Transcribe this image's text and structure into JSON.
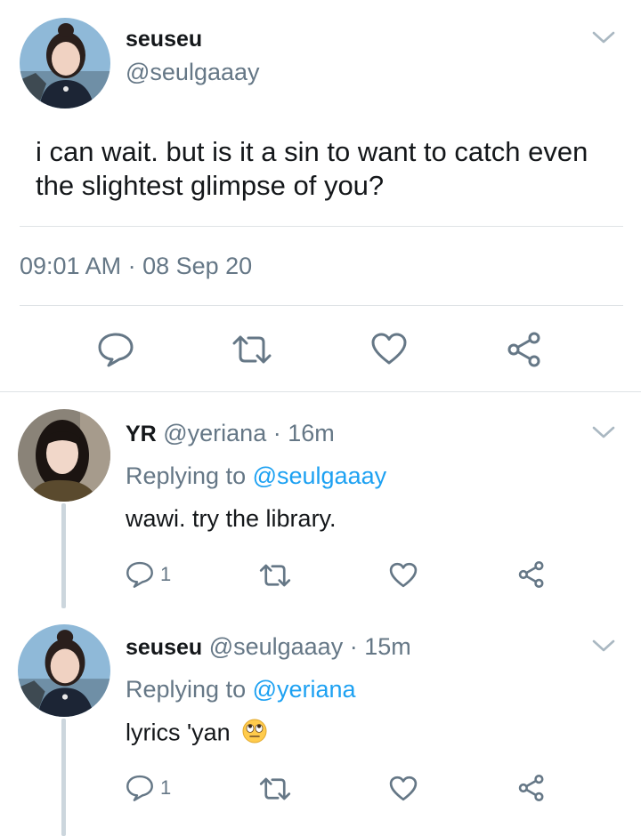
{
  "tweet": {
    "name": "seuseu",
    "handle": "@seulgaaay",
    "text": "i can wait. but is it a sin to want to catch even the slightest glimpse of you?",
    "timestamp": "09:01 AM · 08 Sep 20"
  },
  "replies": [
    {
      "name": "YR",
      "handle": "@yeriana",
      "time": "· 16m",
      "replying_prefix": "Replying to ",
      "replying_to": "@seulgaaay",
      "text": "wawi. try the library.",
      "reply_count": "1"
    },
    {
      "name": "seuseu",
      "handle": "@seulgaaay",
      "time": "· 15m",
      "replying_prefix": "Replying to ",
      "replying_to": "@yeriana",
      "text": "lyrics 'yan",
      "reply_count": "1"
    }
  ],
  "colors": {
    "text": "#14171a",
    "secondary": "#657786",
    "link": "#1da1f2",
    "divider": "#dfe3e6",
    "thread_line": "#ccd6dd"
  },
  "icons": [
    "chevron-down-icon",
    "reply-icon",
    "retweet-icon",
    "like-icon",
    "share-icon",
    "rolling-eyes-emoji"
  ]
}
